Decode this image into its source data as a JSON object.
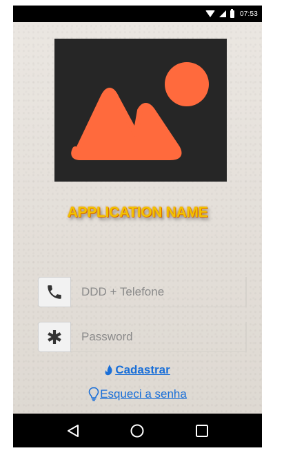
{
  "status_bar": {
    "time": "07:53",
    "icons": [
      "wifi-icon",
      "signal-icon",
      "battery-icon"
    ]
  },
  "logo": {
    "icon": "image-placeholder-icon",
    "background": "#262626",
    "accent": "#ff6a3d"
  },
  "app": {
    "name": "APPLICATION NAME",
    "name_color": "#f2c200"
  },
  "form": {
    "phone": {
      "icon": "phone-icon",
      "placeholder": "DDD + Telefone",
      "value": ""
    },
    "password": {
      "icon": "asterisk-icon",
      "placeholder": "Password",
      "value": ""
    }
  },
  "links": {
    "register": {
      "icon": "flame-icon",
      "label": "Cadastrar"
    },
    "forgot": {
      "icon": "lightbulb-icon",
      "label": "Esqueci a senha"
    },
    "color": "#1a6fd8"
  },
  "nav_bar": {
    "buttons": [
      "back-icon",
      "home-icon",
      "recents-icon"
    ]
  }
}
